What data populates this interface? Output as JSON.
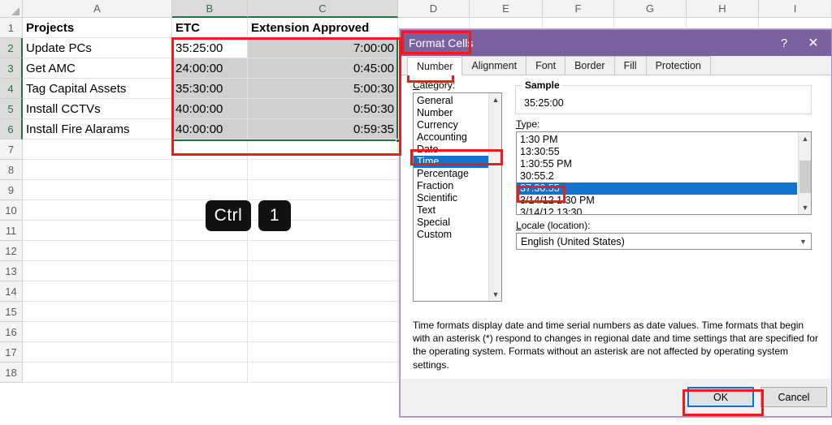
{
  "spreadsheet": {
    "columns": [
      "A",
      "B",
      "C",
      "D",
      "E",
      "F",
      "G",
      "H",
      "I"
    ],
    "selected_columns": [
      "B",
      "C"
    ],
    "rows": [
      "1",
      "2",
      "3",
      "4",
      "5",
      "6",
      "7",
      "8",
      "9",
      "10",
      "11",
      "12",
      "13",
      "14",
      "15",
      "16",
      "17",
      "18"
    ],
    "selected_rows": [
      "2",
      "3",
      "4",
      "5",
      "6"
    ],
    "headers": {
      "a": "Projects",
      "b": "ETC",
      "c": "Extension Approved"
    },
    "data": [
      {
        "project": "Update PCs",
        "etc": "35:25:00",
        "extension": "7:00:00"
      },
      {
        "project": "Get AMC",
        "etc": "24:00:00",
        "extension": "0:45:00"
      },
      {
        "project": "Tag Capital Assets",
        "etc": "35:30:00",
        "extension": "5:00:30"
      },
      {
        "project": "Install CCTVs",
        "etc": "40:00:00",
        "extension": "0:50:30"
      },
      {
        "project": "Install Fire Alarams",
        "etc": "40:00:00",
        "extension": "0:59:35"
      }
    ],
    "active_cell": "B2"
  },
  "shortcut": {
    "key1": "Ctrl",
    "key2": "1"
  },
  "dialog": {
    "title": "Format Cells",
    "help_label": "?",
    "close_label": "✕",
    "tabs": [
      {
        "label": "Number",
        "active": true
      },
      {
        "label": "Alignment",
        "active": false
      },
      {
        "label": "Font",
        "active": false
      },
      {
        "label": "Border",
        "active": false
      },
      {
        "label": "Fill",
        "active": false
      },
      {
        "label": "Protection",
        "active": false
      }
    ],
    "category": {
      "label": "Category:",
      "items": [
        "General",
        "Number",
        "Currency",
        "Accounting",
        "Date",
        "Time",
        "Percentage",
        "Fraction",
        "Scientific",
        "Text",
        "Special",
        "Custom"
      ],
      "selected": "Time"
    },
    "sample": {
      "label": "Sample",
      "value": "35:25:00"
    },
    "type": {
      "label": "Type:",
      "items": [
        "1:30 PM",
        "13:30:55",
        "1:30:55 PM",
        "30:55.2",
        "37:30:55",
        "3/14/12 1:30 PM",
        "3/14/12 13:30"
      ],
      "selected": "37:30:55"
    },
    "locale": {
      "label": "Locale (location):",
      "value": "English (United States)"
    },
    "description": "Time formats display date and time serial numbers as date values.  Time formats that begin with an asterisk (*) respond to changes in regional date and time settings that are specified for the operating system. Formats without an asterisk are not affected by operating system settings.",
    "buttons": {
      "ok": "OK",
      "cancel": "Cancel"
    }
  },
  "colors": {
    "annotation": "#ef1b1b",
    "title_bar": "#7a62a0",
    "list_selection": "#1273cf",
    "excel_green": "#217346",
    "selection_fill": "#d0d0d0"
  }
}
